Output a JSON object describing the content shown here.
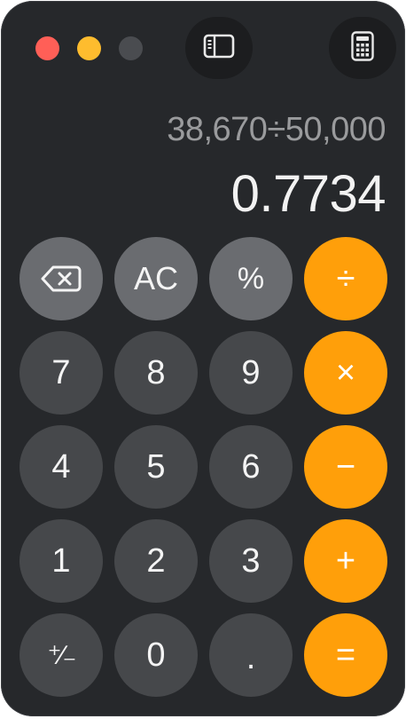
{
  "window": {
    "controls": {
      "close_color": "#ff5f57",
      "minimize_color": "#febc2e",
      "zoom_color": "#4a4c50"
    },
    "toolbar": {
      "sidebar_icon": "sidebar-toggle-icon",
      "mode_icon": "calculator-mode-icon"
    }
  },
  "display": {
    "expression": "38,670÷50,000",
    "result": "0.7734"
  },
  "keypad": {
    "row1": [
      "⌫",
      "AC",
      "%",
      "÷"
    ],
    "row2": [
      "7",
      "8",
      "9",
      "×"
    ],
    "row3": [
      "4",
      "5",
      "6",
      "−"
    ],
    "row4": [
      "1",
      "2",
      "3",
      "+"
    ],
    "row5": [
      "⁺∕₋",
      "0",
      ".",
      "="
    ]
  },
  "colors": {
    "background": "#26282b",
    "function_key": "#6a6c70",
    "number_key": "#46484b",
    "operator_key": "#ff9f0a",
    "text": "#f4f4f4"
  }
}
